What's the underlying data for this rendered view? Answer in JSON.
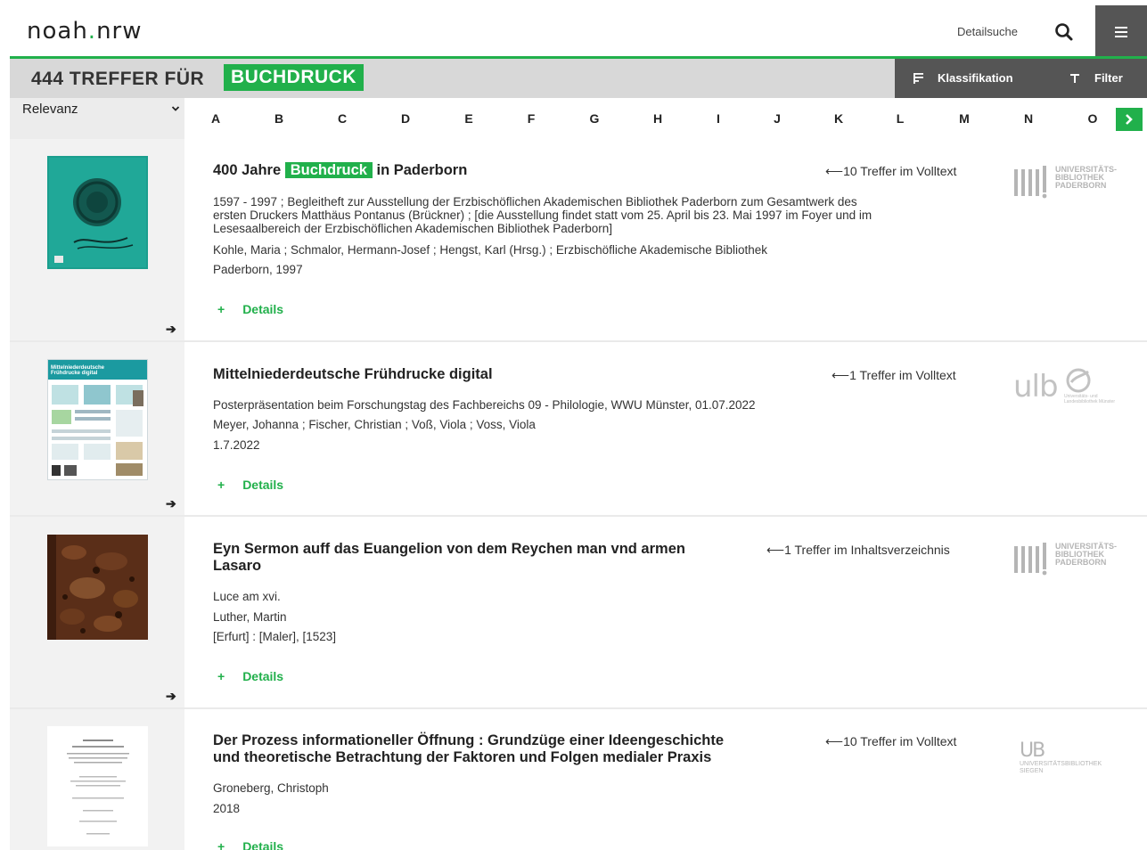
{
  "header": {
    "logo_left": "noah",
    "logo_dot": ".",
    "logo_right": "nrw",
    "detailsuche": "Detailsuche"
  },
  "colors": {
    "accent": "#21b04b",
    "dark": "#555555",
    "grey": "#d8d8d8"
  },
  "results_bar": {
    "count_label": "444 TREFFER FÜR",
    "term": "BUCHDRUCK",
    "klassifikation": "Klassifikation",
    "filter": "Filter"
  },
  "sort": {
    "selected": "Relevanz"
  },
  "alphabet": [
    "A",
    "B",
    "C",
    "D",
    "E",
    "F",
    "G",
    "H",
    "I",
    "J",
    "K",
    "L",
    "M",
    "N",
    "O"
  ],
  "results": [
    {
      "title_pre": "400 Jahre ",
      "title_hl": "Buchdruck",
      "title_post": " in Paderborn",
      "hits": "⟵10 Treffer im Volltext",
      "lines": [
        "1597 - 1997 ; Begleitheft zur Ausstellung der Erzbischöflichen Akademischen Bibliothek Paderborn zum Gesamtwerk des",
        "ersten Druckers Matthäus Pontanus (Brückner) ; [die Ausstellung findet statt vom 25. April bis 23. Mai 1997 im Foyer und im",
        "Lesesaalbereich der Erzbischöflichen Akademischen Bibliothek Paderborn]",
        "Kohle, Maria ; Schmalor, Hermann-Josef ; Hengst, Karl (Hrsg.) ; Erzbischöfliche Akademische Bibliothek",
        "Paderborn, 1997"
      ],
      "details": "Details",
      "inst": [
        "UNIVERSITÄTS-",
        "BIBLIOTHEK",
        "PADERBORN"
      ]
    },
    {
      "title": "Mittelniederdeutsche Frühdrucke digital",
      "hits": "⟵1 Treffer im Volltext",
      "lines": [
        "Posterpräsentation beim Forschungstag des Fachbereichs 09 - Philologie, WWU Münster, 01.07.2022",
        "Meyer, Johanna ; Fischer, Christian ; Voß, Viola ; Voss, Viola",
        "1.7.2022"
      ],
      "details": "Details",
      "poster_title": [
        "Mittelniederdeutsche",
        "Frühdrucke digital"
      ],
      "inst_ulb": "ulb",
      "inst_ulb_sub": [
        "Universitäts- und",
        "Landesbibliothek Münster"
      ]
    },
    {
      "title_lines": [
        "Eyn Sermon auff das Euangelion von dem Reychen man vnd armen",
        "Lasaro"
      ],
      "hits": "⟵1 Treffer im Inhaltsverzeichnis",
      "lines": [
        "Luce am xvi.",
        "Luther, Martin",
        "[Erfurt] : [Maler], [1523]"
      ],
      "details": "Details",
      "inst": [
        "UNIVERSITÄTS-",
        "BIBLIOTHEK",
        "PADERBORN"
      ]
    },
    {
      "title_lines": [
        "Der Prozess informationeller Öffnung : Grundzüge einer Ideengeschichte",
        "und theoretische Betrachtung der Faktoren und Folgen medialer Praxis"
      ],
      "hits": "⟵10 Treffer im Volltext",
      "lines": [
        "Groneberg, Christoph",
        "2018"
      ],
      "details": "Details",
      "inst_ub": "UB",
      "inst_ub_sub": [
        "UNIVERSITÄTSBIBLIOTHEK",
        "SIEGEN"
      ]
    }
  ]
}
